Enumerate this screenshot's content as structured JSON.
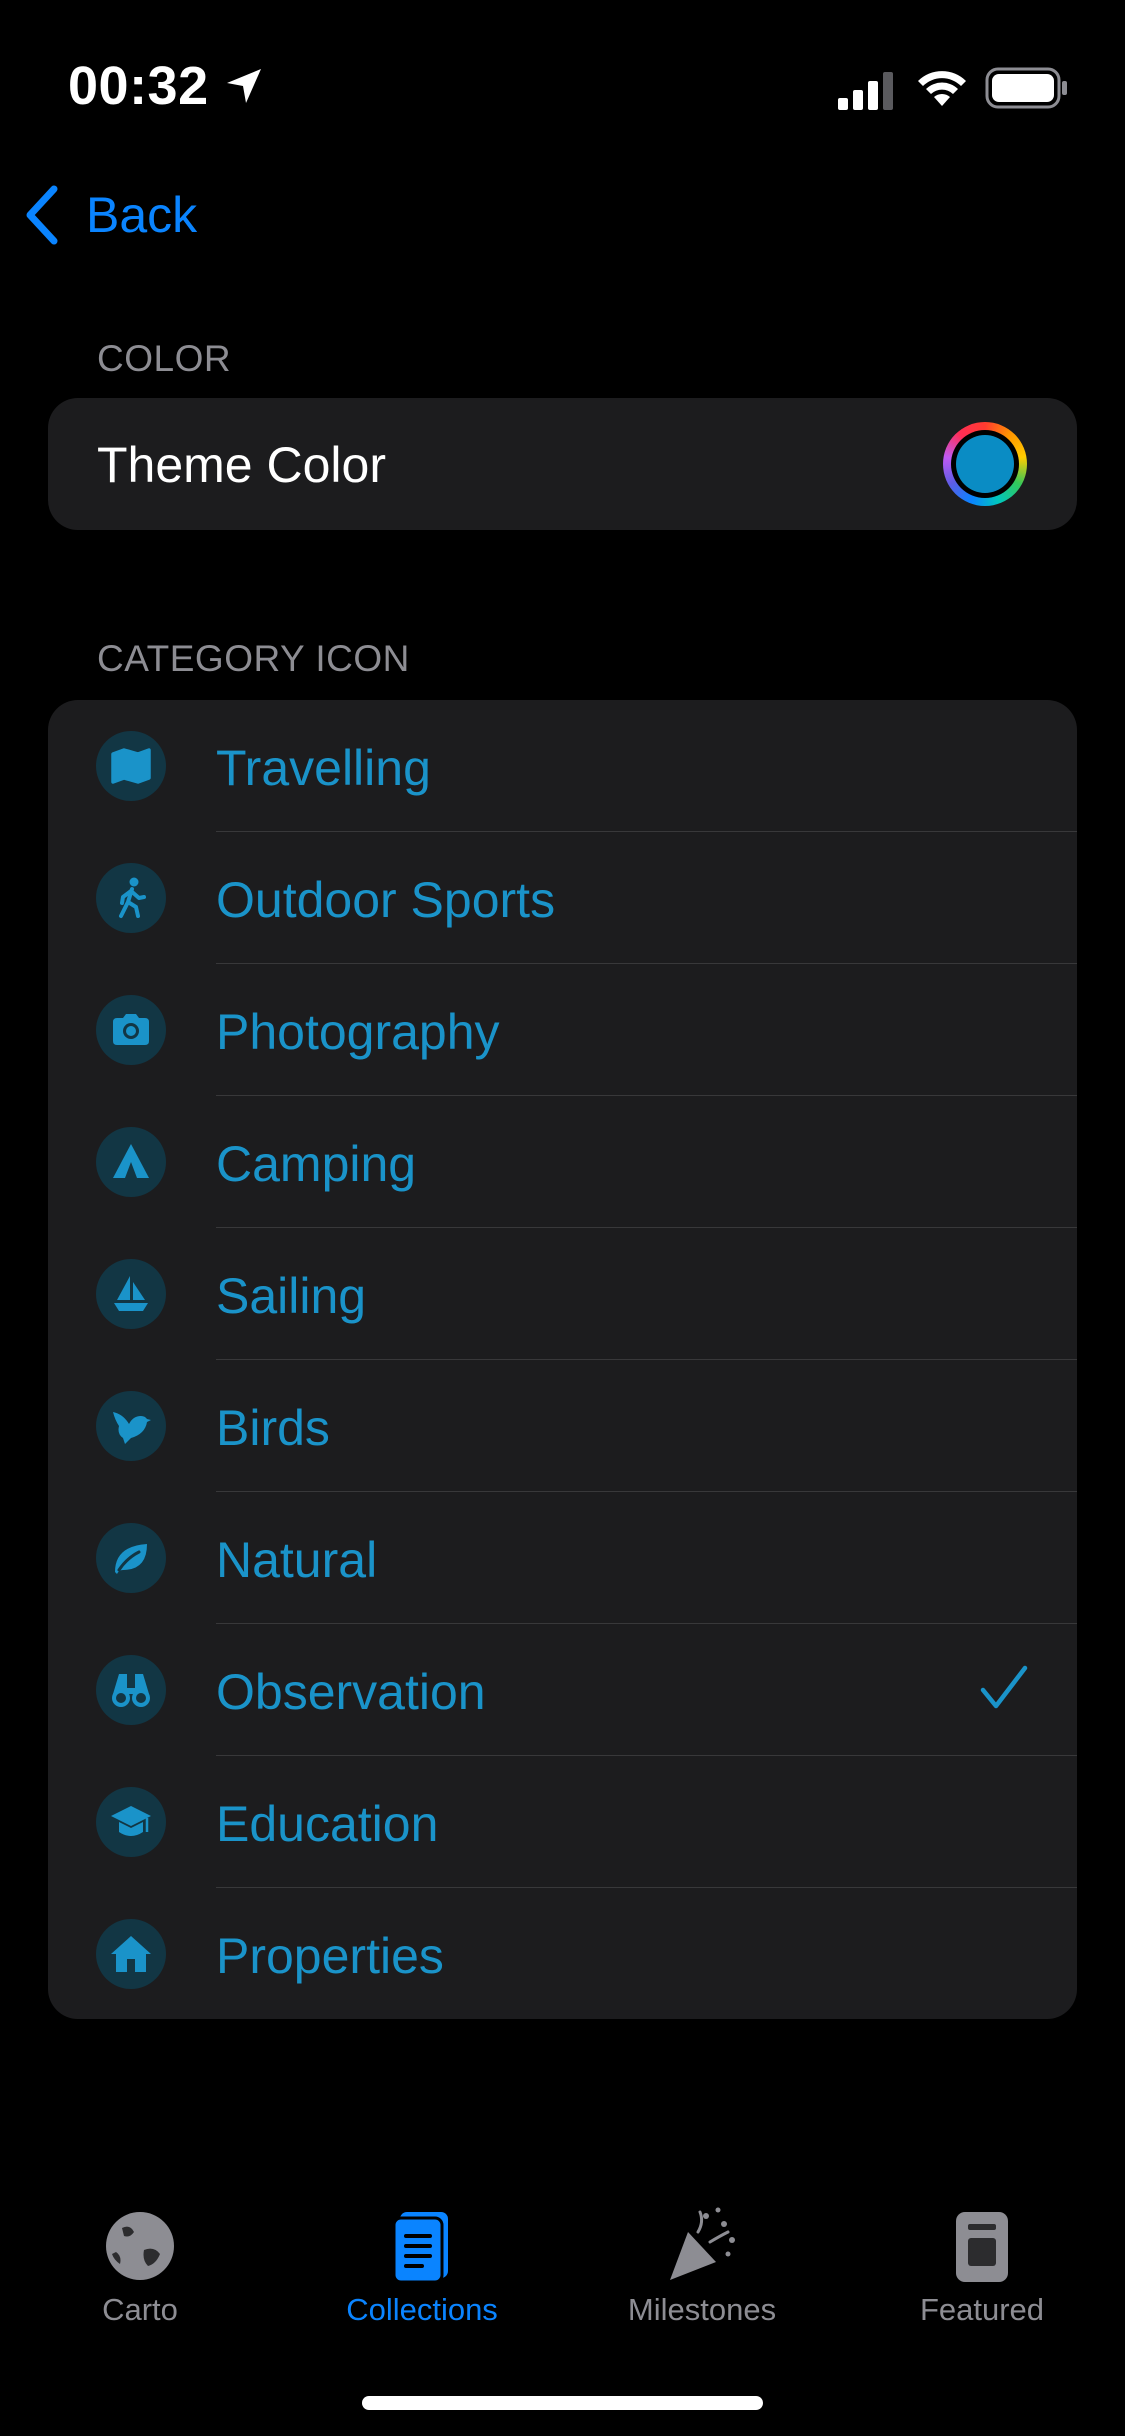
{
  "status_bar": {
    "time": "00:32"
  },
  "nav": {
    "back_label": "Back"
  },
  "color_section": {
    "header": "COLOR",
    "theme_label": "Theme Color",
    "theme_color": "#0a8cc4"
  },
  "category_section": {
    "header": "CATEGORY ICON",
    "accent_color": "#1a93c9",
    "selected": "Observation",
    "items": [
      {
        "label": "Travelling",
        "icon": "map-icon"
      },
      {
        "label": "Outdoor Sports",
        "icon": "hiker-icon"
      },
      {
        "label": "Photography",
        "icon": "camera-icon"
      },
      {
        "label": "Camping",
        "icon": "tent-icon"
      },
      {
        "label": "Sailing",
        "icon": "sailboat-icon"
      },
      {
        "label": "Birds",
        "icon": "bird-icon"
      },
      {
        "label": "Natural",
        "icon": "leaf-icon"
      },
      {
        "label": "Observation",
        "icon": "binoculars-icon"
      },
      {
        "label": "Education",
        "icon": "graduation-cap-icon"
      },
      {
        "label": "Properties",
        "icon": "house-icon"
      }
    ]
  },
  "tab_bar": {
    "active": "Collections",
    "tabs": [
      {
        "label": "Carto",
        "icon": "globe-icon"
      },
      {
        "label": "Collections",
        "icon": "book-icon"
      },
      {
        "label": "Milestones",
        "icon": "party-popper-icon"
      },
      {
        "label": "Featured",
        "icon": "featured-card-icon"
      }
    ]
  },
  "colors": {
    "background": "#000000",
    "card": "#1c1c1e",
    "ios_blue": "#0a84ff",
    "secondary_text": "#8d8d93"
  }
}
